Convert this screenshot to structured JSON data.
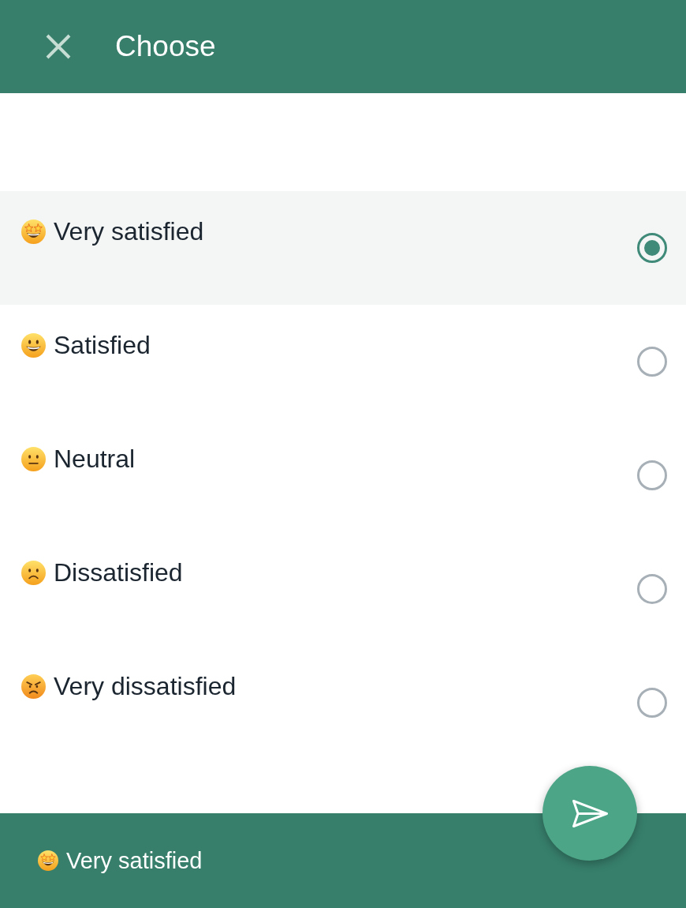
{
  "header": {
    "title": "Choose"
  },
  "options": [
    {
      "label": "Very satisfied",
      "kind": "starstruck",
      "selected": true
    },
    {
      "label": "Satisfied",
      "kind": "grinning",
      "selected": false
    },
    {
      "label": "Neutral",
      "kind": "neutral",
      "selected": false
    },
    {
      "label": "Dissatisfied",
      "kind": "frowning",
      "selected": false
    },
    {
      "label": "Very dissatisfied",
      "kind": "angry",
      "selected": false
    }
  ],
  "footer": {
    "selection": {
      "label": "Very satisfied",
      "kind": "starstruck"
    }
  }
}
